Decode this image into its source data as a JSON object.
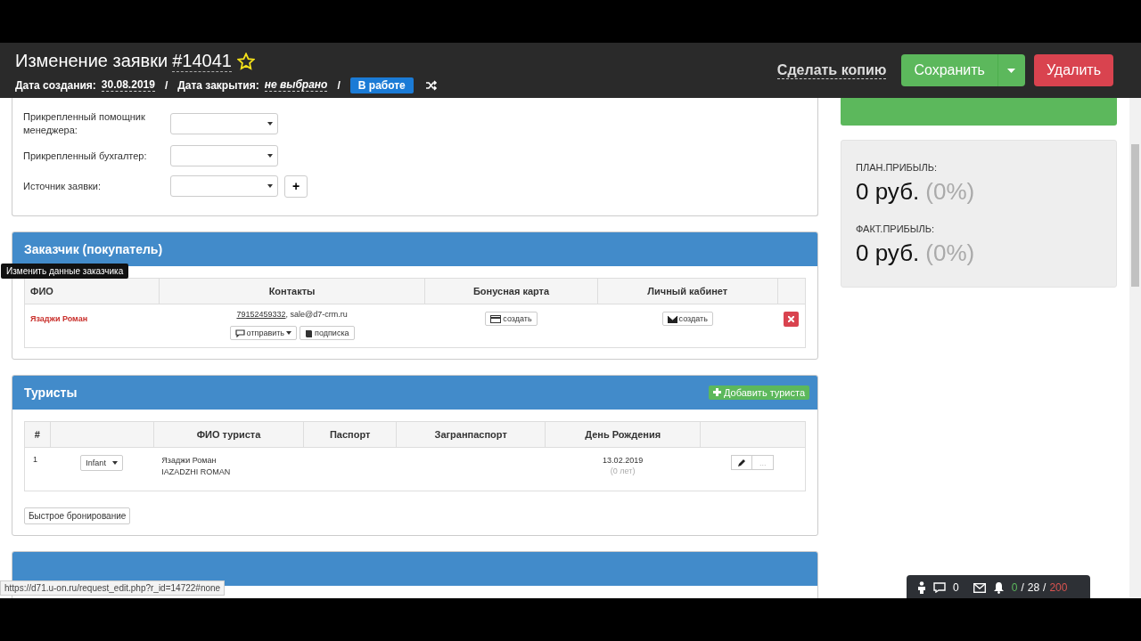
{
  "header": {
    "title": "Изменение заявки",
    "number": "#14041",
    "starred": false,
    "created_label": "Дата создания:",
    "created": "30.08.2019",
    "closed_label": "Дата закрытия:",
    "closed": "не выбрано",
    "separator": "/",
    "status": "В работе",
    "copy": "Сделать копию",
    "save": "Сохранить",
    "delete": "Удалить"
  },
  "form_fields": [
    {
      "label": "Прикрепленный помощник менеджера:"
    },
    {
      "label": "Прикрепленный бухгалтер:"
    },
    {
      "label": "Источник заявки:",
      "add_button": "+"
    }
  ],
  "customer": {
    "title": "Заказчик (покупатель)",
    "columns": [
      {
        "label": "ФИО"
      },
      {
        "label": "Контакты"
      },
      {
        "label": "Бонусная карта"
      },
      {
        "label": "Личный кабинет"
      }
    ],
    "tooltip": "Изменить данные заказчика",
    "rows": [
      {
        "name": "Язаджи Роман",
        "phone": "79152459332",
        "email": ", sale@d7-crm.ru",
        "send": "отправить",
        "subscribe": "подписка",
        "bonus": "создать",
        "cabinet": "создать"
      }
    ]
  },
  "tourists": {
    "title": "Туристы",
    "add": "Добавить туриста",
    "columns": [
      {
        "label": "#"
      },
      {
        "label": "ФИО туриста"
      },
      {
        "label": "Паспорт"
      },
      {
        "label": "Загранпаспорт"
      },
      {
        "label": "День Рождения"
      }
    ],
    "rows": [
      {
        "num": "1",
        "type": "Infant",
        "name": "Язаджи Роман",
        "latin": "IAZADZHI ROMAN",
        "birthday": "13.02.2019",
        "age": "(0 лет)",
        "more": "..."
      }
    ],
    "quick_booking": "Быстрое бронирование"
  },
  "profit": [
    {
      "label": "ПЛАН.ПРИБЫЛЬ:",
      "amount": "0 руб.",
      "percent": "(0%)"
    },
    {
      "label": "ФАКТ.ПРИБЫЛЬ:",
      "amount": "0 руб.",
      "percent": "(0%)"
    }
  ],
  "notifications": {
    "chat": "0",
    "separator": "/",
    "bell_counts": [
      {
        "value": "0",
        "color": "#5cb85c"
      },
      {
        "value": "28",
        "color": "#ffffff"
      },
      {
        "value": "200",
        "color": "#d9534f"
      }
    ]
  },
  "status_url": "https://d71.u-on.ru/request_edit.php?r_id=14722#none"
}
